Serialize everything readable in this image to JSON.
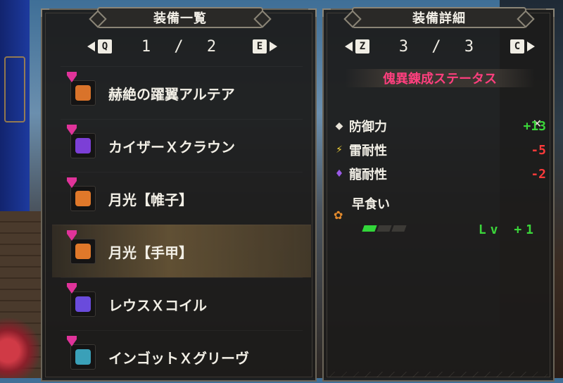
{
  "left_panel": {
    "title": "装備一覧",
    "pager": {
      "prev_key": "Q",
      "next_key": "E",
      "page": "1 / 2"
    },
    "items": [
      {
        "name": "赫絶の躍翼アルテア",
        "icon": "waist-armor-icon",
        "color": "#d9732a",
        "selected": false
      },
      {
        "name": "カイザーＸクラウン",
        "icon": "helm-icon",
        "color": "#7c3fd6",
        "selected": false
      },
      {
        "name": "月光【帷子】",
        "icon": "chest-armor-icon",
        "color": "#e0782a",
        "selected": false
      },
      {
        "name": "月光【手甲】",
        "icon": "gauntlet-icon",
        "color": "#e0782a",
        "selected": true
      },
      {
        "name": "レウスＸコイル",
        "icon": "coil-icon",
        "color": "#6a4bdc",
        "selected": false
      },
      {
        "name": "インゴットＸグリーヴ",
        "icon": "greaves-icon",
        "color": "#3aa0b8",
        "selected": false
      }
    ]
  },
  "right_panel": {
    "title": "装備詳細",
    "pager": {
      "prev_key": "Z",
      "next_key": "C",
      "page": "3 / 3"
    },
    "section_title": "傀異錬成ステータス",
    "stats": [
      {
        "icon": "defense-diamond-icon",
        "label": "防御力",
        "value": "+13",
        "sign": "pos"
      },
      {
        "icon": "thunder-icon",
        "label": "雷耐性",
        "value": "-5",
        "sign": "neg"
      },
      {
        "icon": "dragon-icon",
        "label": "龍耐性",
        "value": "-2",
        "sign": "neg"
      }
    ],
    "skill": {
      "name": "早食い",
      "level": "Lv +1",
      "bars_filled": 1,
      "bars_total": 3
    }
  }
}
